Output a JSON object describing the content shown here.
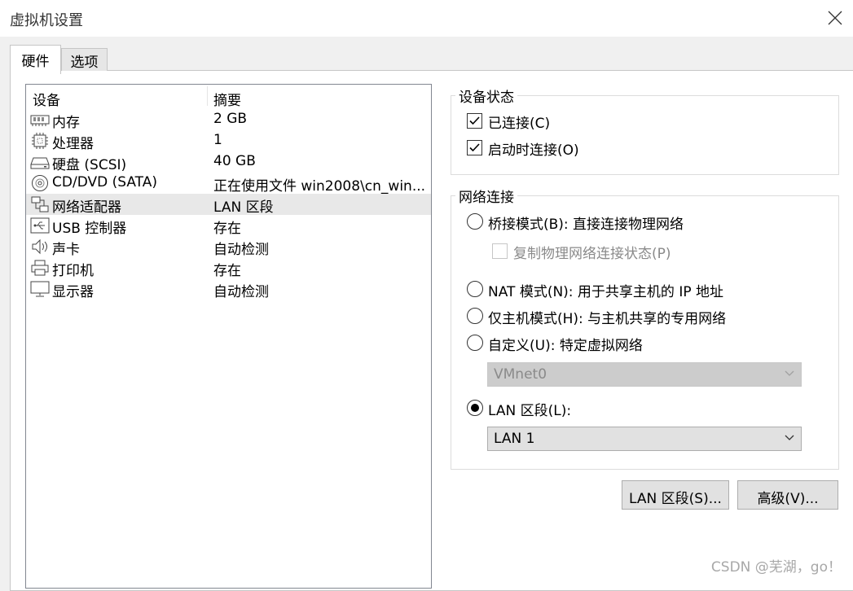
{
  "window": {
    "title": "虚拟机设置"
  },
  "tabs": [
    "硬件",
    "选项"
  ],
  "device_list": {
    "headers": {
      "device": "设备",
      "summary": "摘要"
    },
    "rows": [
      {
        "icon": "memory-icon",
        "name": "内存",
        "summary": "2 GB"
      },
      {
        "icon": "processor-icon",
        "name": "处理器",
        "summary": "1"
      },
      {
        "icon": "hard-disk-icon",
        "name": "硬盘 (SCSI)",
        "summary": "40 GB"
      },
      {
        "icon": "cd-dvd-icon",
        "name": "CD/DVD (SATA)",
        "summary": "正在使用文件 win2008\\cn_win..."
      },
      {
        "icon": "network-adapter-icon",
        "name": "网络适配器",
        "summary": "LAN 区段",
        "selected": true
      },
      {
        "icon": "usb-icon",
        "name": "USB 控制器",
        "summary": "存在"
      },
      {
        "icon": "sound-card-icon",
        "name": "声卡",
        "summary": "自动检测"
      },
      {
        "icon": "printer-icon",
        "name": "打印机",
        "summary": "存在"
      },
      {
        "icon": "display-icon",
        "name": "显示器",
        "summary": "自动检测"
      }
    ]
  },
  "device_status": {
    "legend": "设备状态",
    "connected": {
      "label": "已连接(C)",
      "checked": true
    },
    "connect_at_power_on": {
      "label": "启动时连接(O)",
      "checked": true
    }
  },
  "network_connection": {
    "legend": "网络连接",
    "bridged": {
      "label": "桥接模式(B): 直接连接物理网络",
      "selected": false
    },
    "replicate_state": {
      "label": "复制物理网络连接状态(P)",
      "checked": false,
      "enabled": false
    },
    "nat": {
      "label": "NAT 模式(N): 用于共享主机的 IP 地址",
      "selected": false
    },
    "host_only": {
      "label": "仅主机模式(H): 与主机共享的专用网络",
      "selected": false
    },
    "custom": {
      "label": "自定义(U): 特定虚拟网络",
      "selected": false
    },
    "custom_select": {
      "value": "VMnet0",
      "enabled": false
    },
    "lan_segment": {
      "label": "LAN 区段(L):",
      "selected": true
    },
    "lan_select": {
      "value": "LAN 1",
      "enabled": true
    }
  },
  "buttons": {
    "lan_segments": "LAN 区段(S)...",
    "advanced": "高级(V)..."
  },
  "watermark": "CSDN @芜湖，go！"
}
